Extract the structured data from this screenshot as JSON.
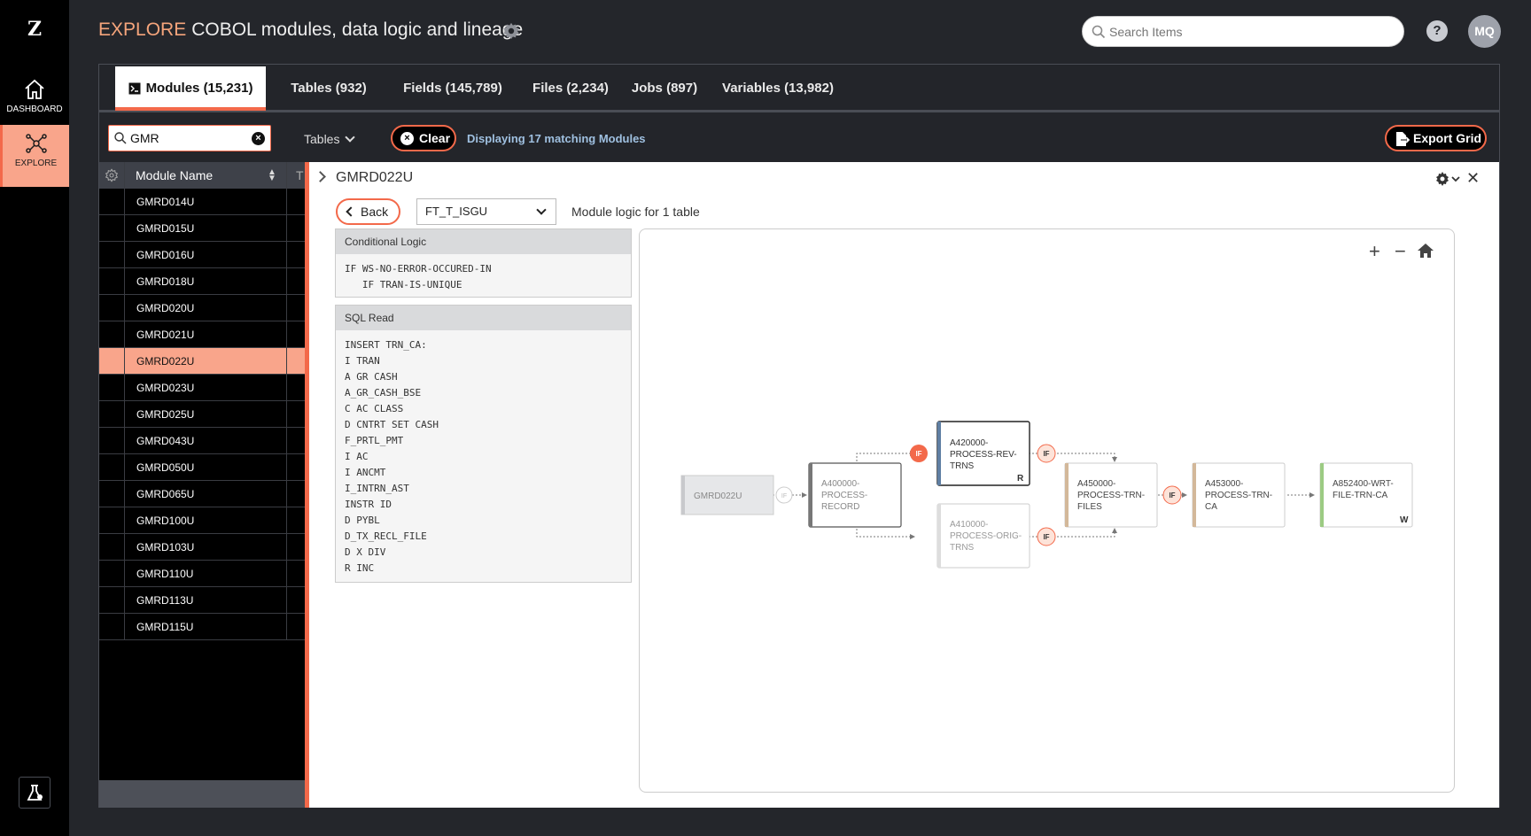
{
  "rail": {
    "logo": "Z",
    "items": [
      {
        "label": "DASHBOARD",
        "icon": "home-icon"
      },
      {
        "label": "EXPLORE",
        "icon": "graph-network-icon"
      }
    ],
    "lab_icon": "lab-flask-icon"
  },
  "header": {
    "section": "EXPLORE",
    "title": "COBOL modules, data logic and lineage",
    "search_placeholder": "Search Items",
    "help": "?",
    "avatar": "MQ"
  },
  "tabs": [
    {
      "label": "Modules (15,231)",
      "active": true
    },
    {
      "label": "Tables (932)"
    },
    {
      "label": "Fields (145,789)"
    },
    {
      "label": "Files (2,234)"
    },
    {
      "label": "Jobs (897)"
    },
    {
      "label": "Variables (13,982)"
    }
  ],
  "filter": {
    "query": "GMR",
    "type_dropdown": "Tables",
    "clear_label": "Clear",
    "match_text": "Displaying 17 matching Modules",
    "export_label": "Export Grid"
  },
  "grid": {
    "column": "Module Name",
    "next_column_initial": "T",
    "rows": [
      "GMRD014U",
      "GMRD015U",
      "GMRD016U",
      "GMRD018U",
      "GMRD020U",
      "GMRD021U",
      "GMRD022U",
      "GMRD023U",
      "GMRD025U",
      "GMRD043U",
      "GMRD050U",
      "GMRD065U",
      "GMRD100U",
      "GMRD103U",
      "GMRD110U",
      "GMRD113U",
      "GMRD115U"
    ],
    "selected": "GMRD022U"
  },
  "detail": {
    "title": "GMRD022U",
    "back_label": "Back",
    "table_select": "FT_T_ISGU",
    "module_logic": "Module logic for 1 table",
    "conditional": {
      "header": "Conditional Logic",
      "code": "IF WS-NO-ERROR-OCCURED-IN\n   IF TRAN-IS-UNIQUE"
    },
    "sql": {
      "header": "SQL Read",
      "code": "INSERT TRN_CA:\nI TRAN\nA GR CASH\nA_GR_CASH_BSE\nC AC CLASS\nD CNTRT SET CASH\nF_PRTL_PMT\nI AC\nI ANCMT\nI_INTRN_AST\nINSTR ID\nD PYBL\nD_TX_RECL_FILE\nD X DIV\nR INC"
    }
  },
  "flow": {
    "zoom_in": "+",
    "zoom_out": "−",
    "home_icon": "home-icon",
    "if_label": "IF",
    "nodes": {
      "root": "GMRD022U",
      "n1": [
        "A400000-",
        "PROCESS-",
        "RECORD"
      ],
      "n2": [
        "A420000-",
        "PROCESS-REV-",
        "TRNS"
      ],
      "n2_badge": "R",
      "n3": [
        "A410000-",
        "PROCESS-ORIG-",
        "TRNS"
      ],
      "n4": [
        "A450000-",
        "PROCESS-TRN-",
        "FILES"
      ],
      "n5": [
        "A453000-",
        "PROCESS-TRN-",
        "CA"
      ],
      "n6": [
        "A852400-WRT-",
        "FILE-TRN-CA"
      ],
      "n6_badge": "W"
    },
    "colors": {
      "accent": "#f3694a",
      "blue": "#5f7fa3",
      "tan": "#d3b89a",
      "green": "#9ccb83"
    }
  }
}
